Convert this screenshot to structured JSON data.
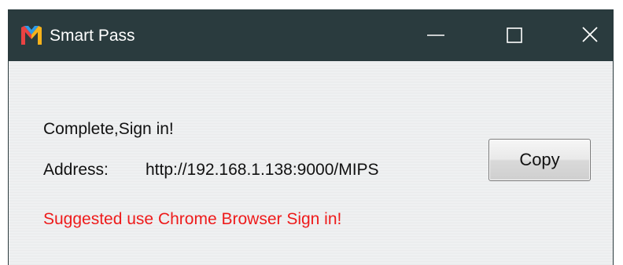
{
  "window": {
    "title": "Smart Pass",
    "icon": "m-logo-icon",
    "controls": [
      "minimize-icon",
      "maximize-icon",
      "close-icon"
    ],
    "titlebar_color": "#2a3b3e"
  },
  "content": {
    "status_text": "Complete,Sign in!",
    "address_label": "Address:",
    "address_value": "http://192.168.1.138:9000/MIPS",
    "note_text": "Suggested use Chrome Browser Sign in!",
    "note_color": "#ee1b1b",
    "copy_label": "Copy"
  }
}
